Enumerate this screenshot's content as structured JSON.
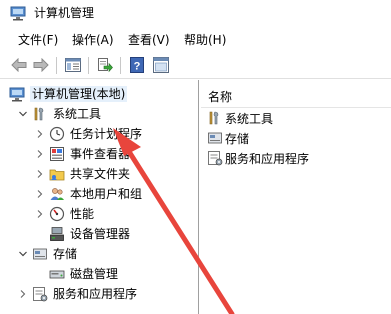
{
  "window": {
    "title": "计算机管理"
  },
  "menu": [
    {
      "label": "文件(F)"
    },
    {
      "label": "操作(A)"
    },
    {
      "label": "查看(V)"
    },
    {
      "label": "帮助(H)"
    }
  ],
  "toolbar": {
    "buttons": [
      "back-arrow-icon",
      "forward-arrow-icon",
      "show-hide-tree-icon",
      "export-list-icon",
      "help-icon",
      "properties-icon"
    ]
  },
  "tree": {
    "items": [
      {
        "label": "计算机管理(本地)",
        "icon": "computer-management-icon"
      },
      {
        "label": "系统工具",
        "icon": "tools-icon"
      },
      {
        "label": "任务计划程序",
        "icon": "clock-icon"
      },
      {
        "label": "事件查看器",
        "icon": "event-viewer-icon"
      },
      {
        "label": "共享文件夹",
        "icon": "shared-folder-icon"
      },
      {
        "label": "本地用户和组",
        "icon": "users-icon"
      },
      {
        "label": "性能",
        "icon": "performance-icon"
      },
      {
        "label": "设备管理器",
        "icon": "device-manager-icon"
      },
      {
        "label": "存储",
        "icon": "storage-icon"
      },
      {
        "label": "磁盘管理",
        "icon": "disk-icon"
      },
      {
        "label": "服务和应用程序",
        "icon": "services-icon"
      }
    ]
  },
  "right": {
    "column_header": "名称",
    "items": [
      {
        "label": "系统工具",
        "icon": "tools-icon"
      },
      {
        "label": "存储",
        "icon": "storage-icon"
      },
      {
        "label": "服务和应用程序",
        "icon": "services-icon"
      }
    ]
  },
  "colors": {
    "annotation_arrow": "#e8453c",
    "selection": "#e5f0fb"
  }
}
